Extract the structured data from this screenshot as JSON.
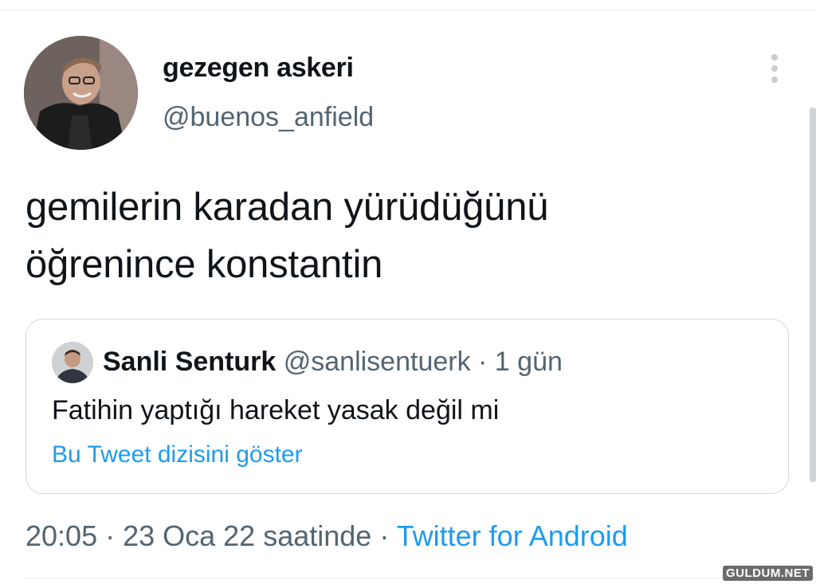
{
  "tweet": {
    "display_name": "gezegen askeri",
    "handle": "@buenos_anfield",
    "text_line1": "gemilerin karadan yürüdüğünü",
    "text_line2": "öğrenince konstantin",
    "timestamp": "20:05 · 23 Oca 22 saatinde",
    "separator": " · ",
    "source": "Twitter for Android"
  },
  "quoted_tweet": {
    "display_name": "Sanli Senturk",
    "handle": "@sanlisentuerk",
    "age": " · 1 gün",
    "text": "Fatihin yaptığı hareket yasak değil mi",
    "thread_link": "Bu Tweet dizisini göster"
  },
  "watermark": "GULDUM.NET",
  "colors": {
    "link_blue": "#1d9bf0",
    "secondary_gray": "#536471",
    "border": "#cfd9de"
  },
  "icons": {
    "more": "vertical-ellipsis"
  }
}
